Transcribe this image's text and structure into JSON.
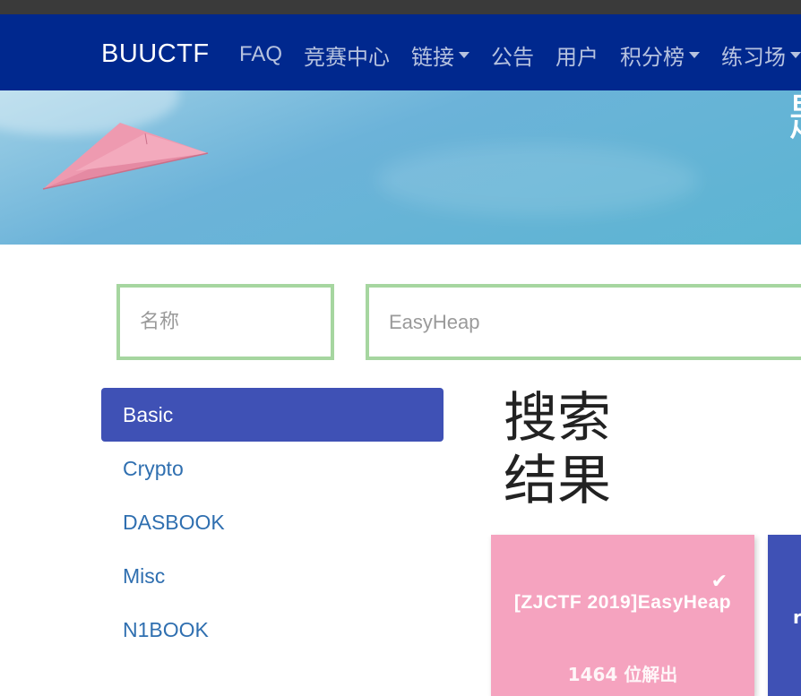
{
  "navbar": {
    "brand": "BUUCTF",
    "items": [
      {
        "label": "FAQ",
        "dropdown": false
      },
      {
        "label": "竞赛中心",
        "dropdown": false
      },
      {
        "label": "链接",
        "dropdown": true
      },
      {
        "label": "公告",
        "dropdown": false
      },
      {
        "label": "用户",
        "dropdown": false
      },
      {
        "label": "积分榜",
        "dropdown": true
      },
      {
        "label": "练习场",
        "dropdown": true
      }
    ]
  },
  "hero": {
    "edge_text": "题"
  },
  "search": {
    "name_placeholder": "名称",
    "query_placeholder": "EasyHeap"
  },
  "sidebar": {
    "items": [
      {
        "label": "Basic",
        "active": true
      },
      {
        "label": "Crypto",
        "active": false
      },
      {
        "label": "DASBOOK",
        "active": false
      },
      {
        "label": "Misc",
        "active": false
      },
      {
        "label": "N1BOOK",
        "active": false
      }
    ]
  },
  "results": {
    "title": "搜索结果",
    "cards": [
      {
        "title": "[ZJCTF 2019]EasyHeap",
        "subtitle": "1464 位解出",
        "solved": true,
        "color": "#f5a3bf"
      },
      {
        "title": "r",
        "color": "#3f51b5"
      }
    ]
  },
  "colors": {
    "navbar_bg": "#00288e",
    "active_tab": "#3f51b5",
    "input_border": "#a6d6a0",
    "link": "#2f6fb0"
  }
}
